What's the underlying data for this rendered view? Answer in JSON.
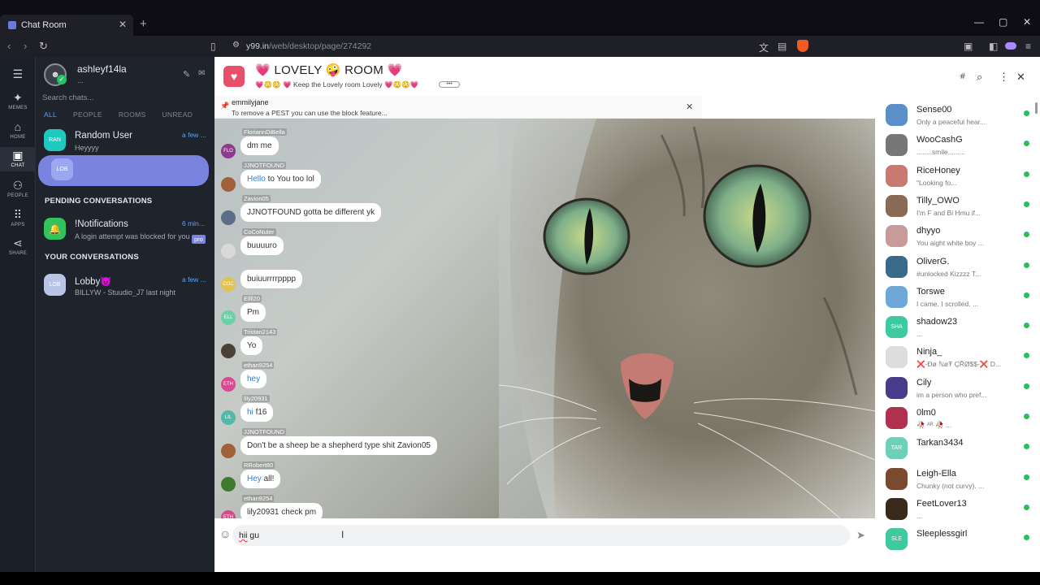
{
  "browser": {
    "tab_title": "Chat Room",
    "tab_close": "✕",
    "new_tab": "+",
    "url_host": "y99.in",
    "url_path": "/web/desktop/page/274292",
    "win_min": "—",
    "win_max": "▢",
    "win_close": "✕"
  },
  "rail": {
    "items": [
      {
        "label": "MEMES",
        "icon": "✦"
      },
      {
        "label": "HOME",
        "icon": "⌂"
      },
      {
        "label": "CHAT",
        "icon": "▣"
      },
      {
        "label": "PEOPLE",
        "icon": "⚇"
      },
      {
        "label": "APPS",
        "icon": "⠿"
      },
      {
        "label": "SHARE",
        "icon": "⋖"
      }
    ]
  },
  "sidebar": {
    "username": "ashleyf14la",
    "status": "...",
    "search_placeholder": "Search chats...",
    "filters": [
      "ALL",
      "PEOPLE",
      "ROOMS",
      "UNREAD"
    ],
    "top_conversations": [
      {
        "name": "Random User",
        "last": "Heyyyy",
        "time": "a few ...",
        "avatar": "RAN",
        "color": "#20c9c0"
      },
      {
        "name": "",
        "last": "",
        "time": "",
        "avatar": "LOB",
        "color": "#9aa8f0"
      }
    ],
    "pending_header": "PENDING CONVERSATIONS",
    "pending": [
      {
        "name": "!Notifications",
        "last": "A login attempt was blocked for you",
        "time": "6 min...",
        "badge": "pro",
        "color": "#34c25d"
      }
    ],
    "yours_header": "YOUR CONVERSATIONS",
    "yours": [
      {
        "name": "Lobby😈",
        "last": "BILLYW - Stuudio_J7 last night",
        "time": "a few ...",
        "avatar": "LOB",
        "color": "#b9c4e6"
      }
    ]
  },
  "room": {
    "title": "💗 LOVELY 🤪 ROOM 💗",
    "subtitle": "💗😳😳 💗 Keep the Lovely room Lovely 💗😳😳💗",
    "more": "•••"
  },
  "pinned": {
    "user": "emmilyjane",
    "text": "To remove a PEST you can use the block feature..."
  },
  "messages": [
    {
      "user": "FloriannDiBella",
      "text": "dm me",
      "avatar": "FLO",
      "color": "#8e3a8e",
      "hl": ""
    },
    {
      "user": "JJNOTFOUND",
      "text": " to You too lol",
      "avatar": "",
      "color": "#a0603a",
      "hl": "Hello"
    },
    {
      "user": "Zavion05",
      "text": "JJNOTFOUND gotta be different yk",
      "avatar": "",
      "color": "#5a6e85",
      "hl": ""
    },
    {
      "user": "CoCoNuter",
      "text": "buuuuro",
      "avatar": "",
      "color": "#d9d9d9",
      "hl": ""
    },
    {
      "user": "",
      "text": "buiuurrrrpppp",
      "avatar": "COC",
      "color": "#e2c44c",
      "hl": ""
    },
    {
      "user": "Ellll20",
      "text": "Pm",
      "avatar": "ELL",
      "color": "#6fcfa6",
      "hl": ""
    },
    {
      "user": "Tristan2143",
      "text": "Yo",
      "avatar": "",
      "color": "#4a4036",
      "hl": ""
    },
    {
      "user": "ethan9254",
      "text": "",
      "avatar": "ETH",
      "color": "#d44c8f",
      "hl": "hey"
    },
    {
      "user": "lily20931",
      "text": " f16",
      "avatar": "LIL",
      "color": "#52b9a8",
      "hl": "hi"
    },
    {
      "user": "JJNOTFOUND",
      "text": "Don't be a sheep be a shepherd type shit Zavion05",
      "avatar": "",
      "color": "#a0603a",
      "hl": ""
    },
    {
      "user": "RRobert80",
      "text": " all!",
      "avatar": "",
      "color": "#3f7a2f",
      "hl": "Hey"
    },
    {
      "user": "ethan9254",
      "text": "lily20931 check pm",
      "avatar": "ETH",
      "color": "#d44c8f",
      "hl": ""
    }
  ],
  "composer": {
    "text_typo": "hii",
    "text_rest": " gu"
  },
  "members": [
    {
      "name": "Sense00",
      "status": "Only a peaceful hear...",
      "avatar": "",
      "color": "#5a8fc9"
    },
    {
      "name": "WooCashG",
      "status": "........smile.........",
      "avatar": "",
      "color": "#777"
    },
    {
      "name": "RiceHoney",
      "status": "\"Looking fo...",
      "avatar": "",
      "color": "#c97a70"
    },
    {
      "name": "Tilly_OWO",
      "status": "I'm F and Bi Hmu if...",
      "avatar": "",
      "color": "#8a6a55"
    },
    {
      "name": "dhyyo",
      "status": "You aight white boy ...",
      "avatar": "",
      "color": "#c99a9a"
    },
    {
      "name": "OliverG.",
      "status": "#unlocked Kizzzz T...",
      "avatar": "",
      "color": "#3a6a8a"
    },
    {
      "name": "Torswe",
      "status": "I came. I scrolled. ...",
      "avatar": "",
      "color": "#6fa8d8"
    },
    {
      "name": "shadow23",
      "status": "...",
      "avatar": "SHA",
      "color": "#3ec9a0"
    },
    {
      "name": "Ninja_",
      "status": "❌-Đø ℕøŦ ÇŘØ$$-❌ D...",
      "avatar": "",
      "color": "#ddd"
    },
    {
      "name": "Cily",
      "status": "im a person who pref...",
      "avatar": "",
      "color": "#4a3a8a"
    },
    {
      "name": "0lm0",
      "status": "🥀 ᴬᴿ 🥀 ...",
      "avatar": "",
      "color": "#b03050"
    },
    {
      "name": "Tarkan3434",
      "status": "",
      "avatar": "TAR",
      "color": "#6fd0b8"
    },
    {
      "name": "Leigh-Ella",
      "status": "Chunky (not curvy). ...",
      "avatar": "",
      "color": "#7a4a30"
    },
    {
      "name": "FeetLover13",
      "status": "...",
      "avatar": "",
      "color": "#3a2a1a"
    },
    {
      "name": "Sleeplessgirl",
      "status": "",
      "avatar": "SLE",
      "color": "#3ec9a0"
    }
  ]
}
